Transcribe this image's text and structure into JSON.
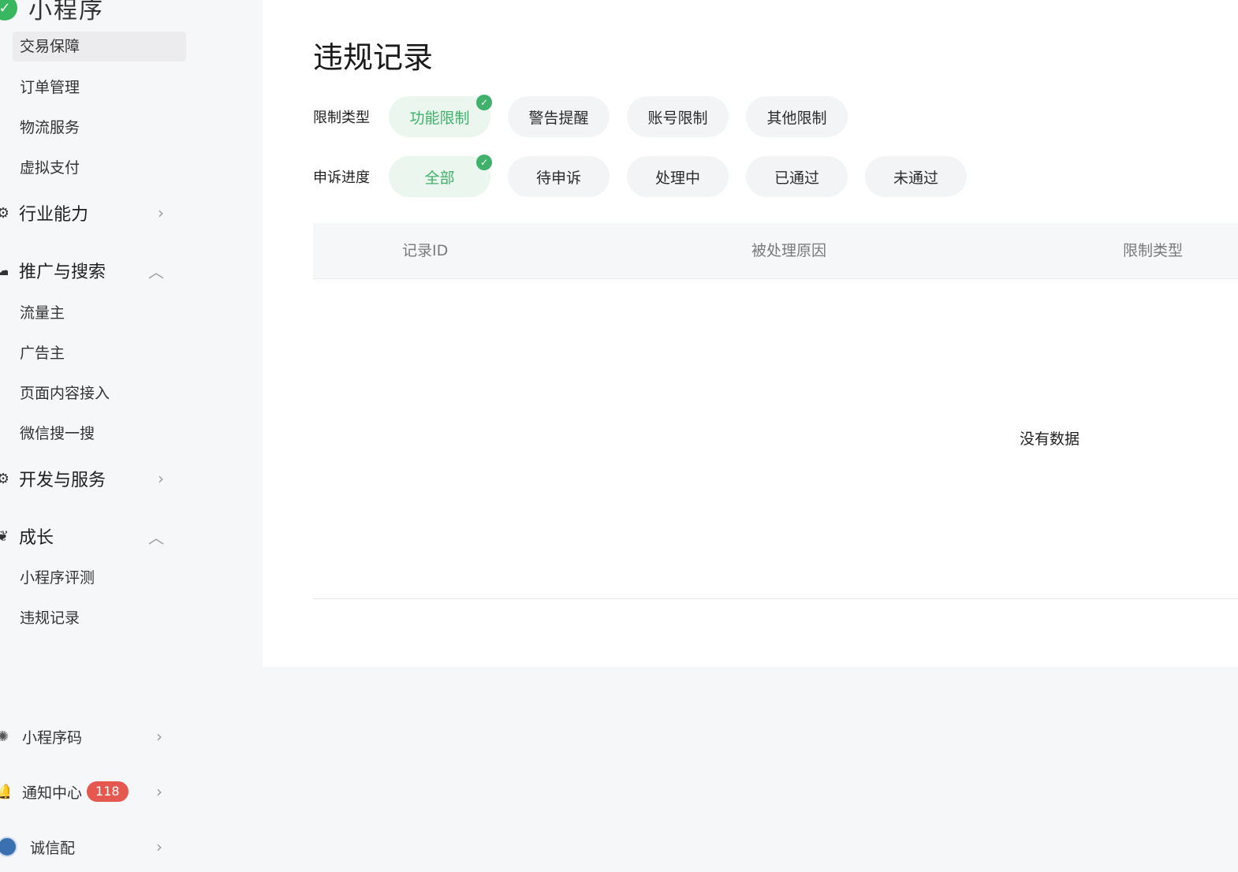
{
  "brand": {
    "name": "小程序",
    "logo_glyph": "✓"
  },
  "sidebar": {
    "sub_items_top": [
      "交易保障",
      "订单管理",
      "物流服务",
      "虚拟支付"
    ],
    "groups": [
      {
        "label": "行业能力",
        "expanded": false,
        "icon": "industry-icon"
      },
      {
        "label": "推广与搜索",
        "expanded": true,
        "icon": "promotion-icon",
        "items": [
          "流量主",
          "广告主",
          "页面内容接入",
          "微信搜一搜"
        ]
      },
      {
        "label": "开发与服务",
        "expanded": false,
        "icon": "develop-icon"
      },
      {
        "label": "成长",
        "expanded": true,
        "icon": "growth-icon",
        "items": [
          "小程序评测",
          "违规记录"
        ]
      }
    ],
    "bottom": [
      {
        "label": "小程序码",
        "icon": "qrcode-icon"
      },
      {
        "label": "通知中心",
        "icon": "bell-icon",
        "badge": "118"
      },
      {
        "label": "诚信配",
        "icon": "avatar-icon"
      }
    ]
  },
  "main": {
    "title": "违规记录",
    "filters": {
      "restriction_label": "限制类型",
      "restriction_options": [
        "功能限制",
        "警告提醒",
        "账号限制",
        "其他限制"
      ],
      "restriction_selected": "功能限制",
      "appeal_label": "申诉进度",
      "appeal_options": [
        "全部",
        "待申诉",
        "处理中",
        "已通过",
        "未通过"
      ],
      "appeal_selected": "全部"
    },
    "table": {
      "headers": [
        "记录ID",
        "被处理原因",
        "限制类型"
      ],
      "empty_text": "没有数据"
    }
  },
  "colors": {
    "accent": "#3fb16a",
    "badge": "#e5584f",
    "panel": "#ffffff",
    "background": "#f6f7f9"
  }
}
